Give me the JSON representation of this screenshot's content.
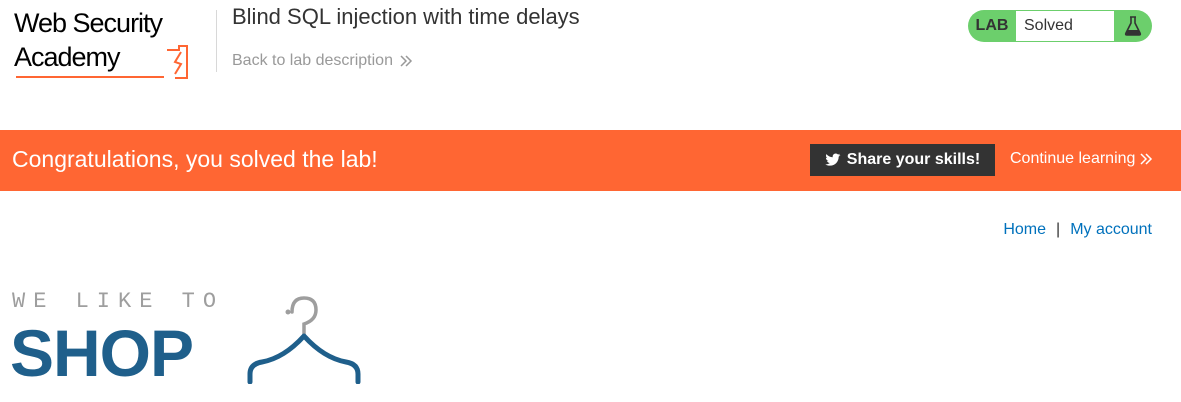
{
  "header": {
    "logo": {
      "line1": "Web Security",
      "line2": "Academy"
    },
    "lab_title": "Blind SQL injection with time delays",
    "back_link_label": "Back to lab description"
  },
  "status": {
    "lab_label": "LAB",
    "status_text": "Solved",
    "icon": "flask-icon",
    "accent_color": "#6ccf6c"
  },
  "banner": {
    "message": "Congratulations, you solved the lab!",
    "share_label": "Share your skills!",
    "share_icon": "twitter-icon",
    "continue_label": "Continue learning",
    "bg_color": "#ff6633"
  },
  "nav": {
    "home": "Home",
    "separator": "|",
    "account": "My account"
  },
  "shop_logo": {
    "tagline": "WE LIKE TO",
    "name": "SHOP",
    "color": "#1f5f8b"
  }
}
